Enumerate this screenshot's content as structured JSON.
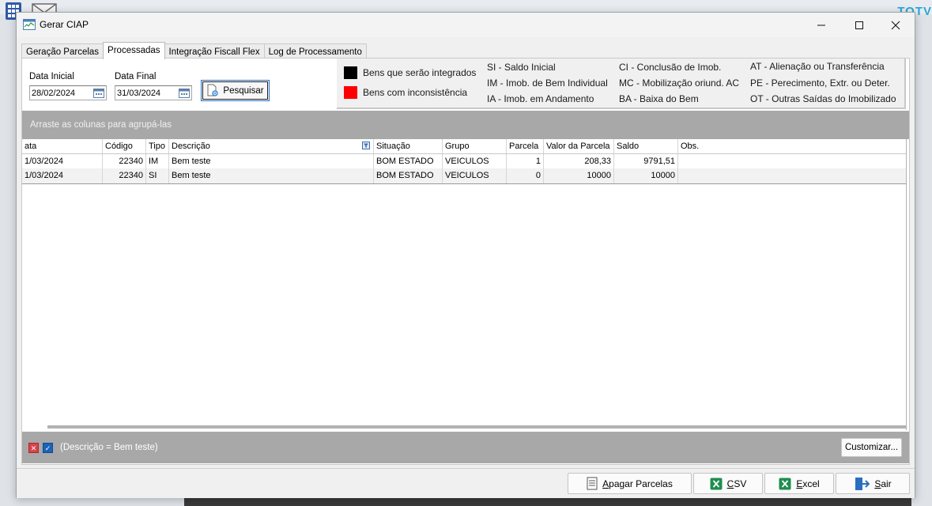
{
  "desktop": {
    "brand": "TOTV"
  },
  "window": {
    "title": "Gerar CIAP",
    "controls": {
      "minimize": "—",
      "maximize": "☐",
      "close": "✕"
    }
  },
  "tabs": [
    {
      "label": "Geração Parcelas",
      "active": false
    },
    {
      "label": "Processadas",
      "active": true
    },
    {
      "label": "Integração Fiscall Flex",
      "active": false
    },
    {
      "label": "Log de Processamento",
      "active": false
    }
  ],
  "filters": {
    "data_inicial_label": "Data Inicial",
    "data_inicial_value": "28/02/2024",
    "data_final_label": "Data Final",
    "data_final_value": "31/03/2024",
    "pesquisar_label": "Pesquisar"
  },
  "legend": {
    "swatches": [
      {
        "color": "#000000",
        "label": "Bens que serão integrados"
      },
      {
        "color": "#ff0000",
        "label": "Bens com inconsistência"
      }
    ],
    "codes": [
      "SI - Saldo Inicial",
      "IM - Imob. de Bem Individual",
      "IA - Imob. em Andamento",
      "CI - Conclusão de Imob.",
      "MC - Mobilização oriund. AC",
      "BA - Baixa do Bem",
      "AT - Alienação ou Transferência",
      "PE - Perecimento, Extr. ou Deter.",
      "OT - Outras Saídas do Imobilizado"
    ]
  },
  "grid": {
    "group_hint": "Arraste as colunas para agrupá-las",
    "columns": [
      "ata",
      "Código",
      "Tipo",
      "Descrição",
      "Situação",
      "Grupo",
      "Parcela",
      "Valor da Parcela",
      "Saldo",
      "Obs."
    ],
    "rows": [
      [
        "1/03/2024",
        "22340",
        "IM",
        "Bem teste",
        "BOM ESTADO",
        "VEICULOS",
        "1",
        "208,33",
        "9791,51",
        ""
      ],
      [
        "1/03/2024",
        "22340",
        "SI",
        "Bem teste",
        "BOM ESTADO",
        "VEICULOS",
        "0",
        "10000",
        "10000",
        ""
      ]
    ],
    "filter_text": "(Descrição = Bem teste)",
    "customizar_label": "Customizar..."
  },
  "footer": {
    "apagar": {
      "prefix": "",
      "accel": "A",
      "rest": "pagar Parcelas"
    },
    "csv": {
      "accel": "C",
      "rest": "SV"
    },
    "excel": {
      "accel": "E",
      "rest": "xcel"
    },
    "sair": {
      "accel": "S",
      "rest": "air"
    }
  }
}
